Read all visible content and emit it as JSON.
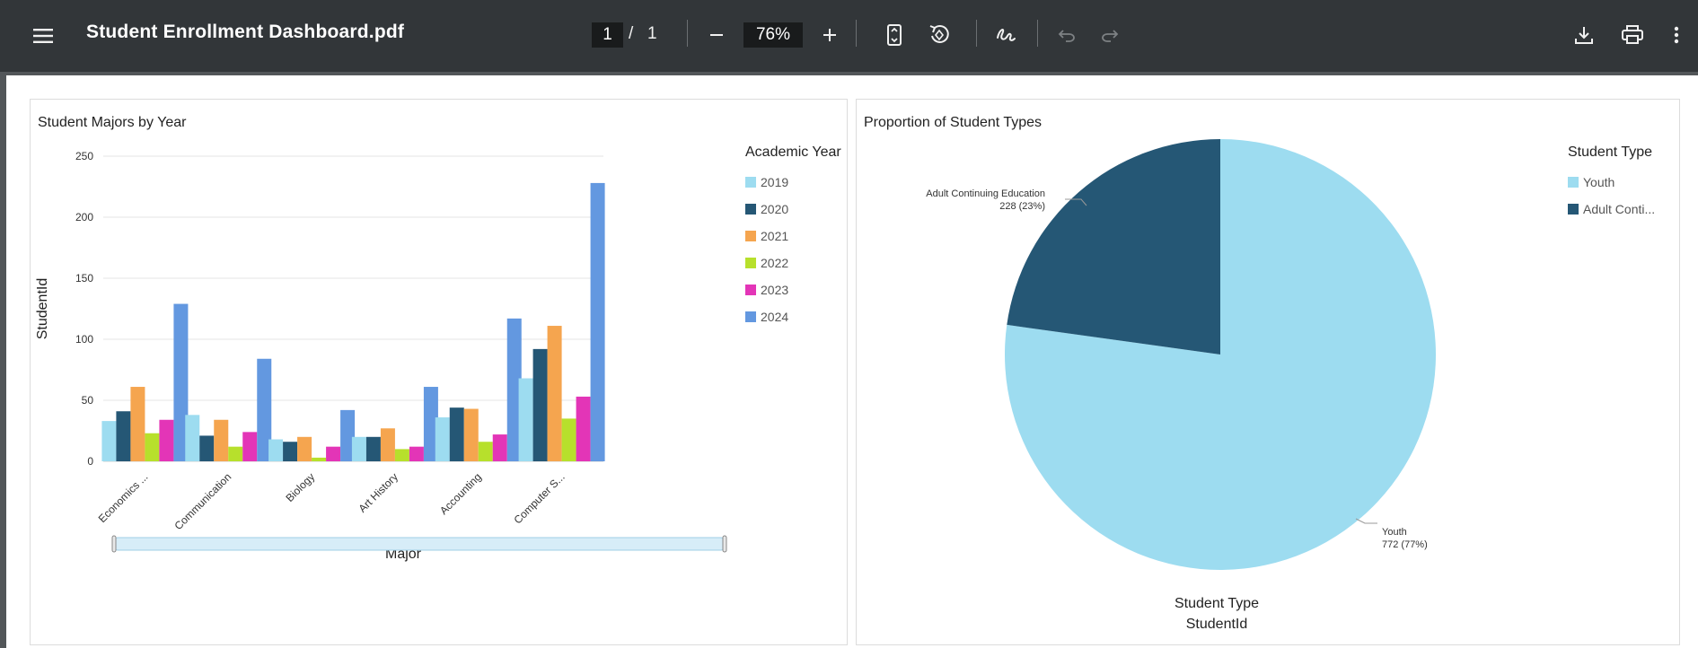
{
  "toolbar": {
    "title": "Student Enrollment Dashboard.pdf",
    "page_current": "1",
    "page_separator": "/",
    "page_total": "1",
    "zoom": "76%",
    "icons": [
      "menu-icon",
      "zoom-out-icon",
      "zoom-in-icon",
      "fit-page-icon",
      "rotate-icon",
      "draw-icon",
      "undo-icon",
      "redo-icon",
      "download-icon",
      "print-icon",
      "more-icon"
    ]
  },
  "bar_panel": {
    "title": "Student Majors by Year",
    "legend_title": "Academic Year"
  },
  "pie_panel": {
    "title": "Proportion of Student Types",
    "legend_title": "Student Type",
    "legend_items": [
      {
        "label": "Youth",
        "color": "#9ddcf0"
      },
      {
        "label": "Adult Conti...",
        "color": "#255775"
      }
    ],
    "slice_labels": [
      {
        "name": "Adult Continuing Education",
        "detail": "228 (23%)"
      },
      {
        "name": "Youth",
        "detail": "772 (77%)"
      }
    ],
    "footer_title": "Student Type",
    "footer_subtitle": "StudentId"
  },
  "chart_data": [
    {
      "type": "bar",
      "title": "Student Majors by Year",
      "xlabel": "Major",
      "ylabel": "StudentId",
      "ylim": [
        0,
        250
      ],
      "yticks": [
        0,
        50,
        100,
        150,
        200,
        250
      ],
      "categories": [
        "Economics ...",
        "Communication",
        "Biology",
        "Art History",
        "Accounting",
        "Computer S..."
      ],
      "legend_title": "Academic Year",
      "legend_position": "right",
      "series": [
        {
          "name": "2019",
          "color": "#9ddcf0",
          "values": [
            33,
            38,
            18,
            20,
            36,
            68
          ]
        },
        {
          "name": "2020",
          "color": "#255775",
          "values": [
            41,
            21,
            16,
            20,
            44,
            92
          ]
        },
        {
          "name": "2021",
          "color": "#f5a54f",
          "values": [
            61,
            34,
            20,
            27,
            43,
            111
          ]
        },
        {
          "name": "2022",
          "color": "#b7e02c",
          "values": [
            23,
            12,
            3,
            10,
            16,
            35
          ]
        },
        {
          "name": "2023",
          "color": "#e335b7",
          "values": [
            34,
            24,
            12,
            12,
            22,
            53
          ]
        },
        {
          "name": "2024",
          "color": "#6398e0",
          "values": [
            129,
            84,
            42,
            61,
            117,
            228
          ]
        }
      ]
    },
    {
      "type": "pie",
      "title": "Proportion of Student Types",
      "legend_title": "Student Type",
      "legend_position": "right",
      "slices": [
        {
          "label": "Youth",
          "value": 772,
          "percent": 77,
          "color": "#9ddcf0"
        },
        {
          "label": "Adult Continuing Education",
          "value": 228,
          "percent": 23,
          "color": "#255775"
        }
      ]
    }
  ]
}
